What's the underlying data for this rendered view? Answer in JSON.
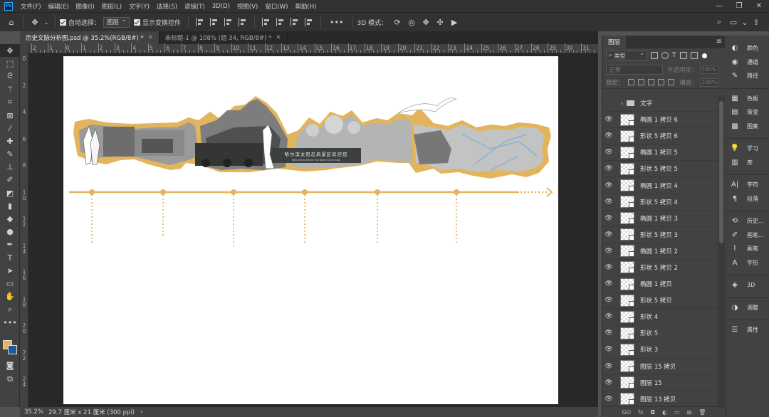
{
  "app": {
    "logo": "Ps"
  },
  "menu": [
    "文件(F)",
    "编辑(E)",
    "图像(I)",
    "图层(L)",
    "文字(Y)",
    "选择(S)",
    "滤镜(T)",
    "3D(D)",
    "视图(V)",
    "窗口(W)",
    "帮助(H)"
  ],
  "window_controls": {
    "minimize": "—",
    "restore": "❐",
    "close": "✕"
  },
  "options": {
    "auto_select_label": "自动选择：",
    "auto_select_value": "图层",
    "show_transform_label": "显示变换控件",
    "more": "•••",
    "mode_3d_label": "3D 模式："
  },
  "tabs": [
    {
      "label": "历史文脉分析图.psd @ 35.2%(RGB/8#) *",
      "active": true
    },
    {
      "label": "未标题-1 @ 108% (组 34, RGB/8#) *",
      "active": false
    }
  ],
  "rulers": {
    "h_labels": [
      "2",
      "1",
      "0",
      "1",
      "2",
      "3",
      "4",
      "5",
      "6",
      "7",
      "8",
      "9",
      "10",
      "11",
      "12",
      "13",
      "14",
      "15",
      "16",
      "17",
      "18",
      "19",
      "20",
      "21",
      "22",
      "23",
      "24",
      "25",
      "26",
      "27",
      "28",
      "29",
      "30",
      "31"
    ],
    "v_labels": [
      "0",
      "2",
      "4",
      "6",
      "8",
      "10",
      "12",
      "14",
      "16",
      "18",
      "20",
      "22",
      "24"
    ]
  },
  "artwork": {
    "sign_text": "哈尔滨太阳岛风景区欢迎您",
    "sign_subtext": "Welcome to Harbin Sun Island Scenic Spot",
    "accent": "#e2b45c"
  },
  "status": {
    "zoom": "35.2%",
    "doc_info": "29.7 厘米 x 21 厘米 (300 ppi)",
    "arrow": "›"
  },
  "layers_panel": {
    "title": "图层",
    "kind_label": "类型",
    "blend_mode": "正常",
    "opacity_label": "不透明度：",
    "opacity_value": "100%",
    "lock_label": "锁定：",
    "fill_label": "填充：",
    "fill_value": "100%",
    "group_name": "文字",
    "layers": [
      "椭圆 1 拷贝 6",
      "形状 5 拷贝 6",
      "椭圆 1 拷贝 5",
      "形状 5 拷贝 5",
      "椭圆 1 拷贝 4",
      "形状 5 拷贝 4",
      "椭圆 1 拷贝 3",
      "形状 5 拷贝 3",
      "椭圆 1 拷贝 2",
      "形状 5 拷贝 2",
      "椭圆 1 拷贝",
      "形状 5 拷贝",
      "形状 4",
      "形状 5",
      "形状 3",
      "图层 15 拷贝",
      "图层 15",
      "图层 13 拷贝"
    ],
    "footer": [
      "GO",
      "fx",
      "◘",
      "◐",
      "▭",
      "⊞",
      "🗑"
    ]
  },
  "dock": [
    {
      "icon": "palette-icon",
      "glyph": "◐",
      "label": "颜色"
    },
    {
      "icon": "channels-icon",
      "glyph": "◉",
      "label": "通道"
    },
    {
      "icon": "paths-icon",
      "glyph": "✎",
      "label": "路径"
    },
    {
      "icon": "swatches-icon",
      "glyph": "▦",
      "label": "色板"
    },
    {
      "icon": "gradient-icon",
      "glyph": "▤",
      "label": "渐变"
    },
    {
      "icon": "patterns-icon",
      "glyph": "▩",
      "label": "图案"
    },
    {
      "icon": "learn-icon",
      "glyph": "💡",
      "label": "学习"
    },
    {
      "icon": "library-icon",
      "glyph": "▥",
      "label": "库"
    },
    {
      "icon": "character-icon",
      "glyph": "A|",
      "label": "字符"
    },
    {
      "icon": "paragraph-icon",
      "glyph": "¶",
      "label": "段落"
    },
    {
      "icon": "history-icon",
      "glyph": "⟲",
      "label": "历史..."
    },
    {
      "icon": "brush-settings-icon",
      "glyph": "✐",
      "label": "画笔..."
    },
    {
      "icon": "brushes-icon",
      "glyph": "⌇",
      "label": "画笔"
    },
    {
      "icon": "glyphs-icon",
      "glyph": "A",
      "label": "字形"
    },
    {
      "icon": "3d-icon",
      "glyph": "◈",
      "label": "3D"
    },
    {
      "icon": "adjustments-icon",
      "glyph": "◑",
      "label": "调整"
    },
    {
      "icon": "properties-icon",
      "glyph": "☰",
      "label": "属性"
    }
  ]
}
